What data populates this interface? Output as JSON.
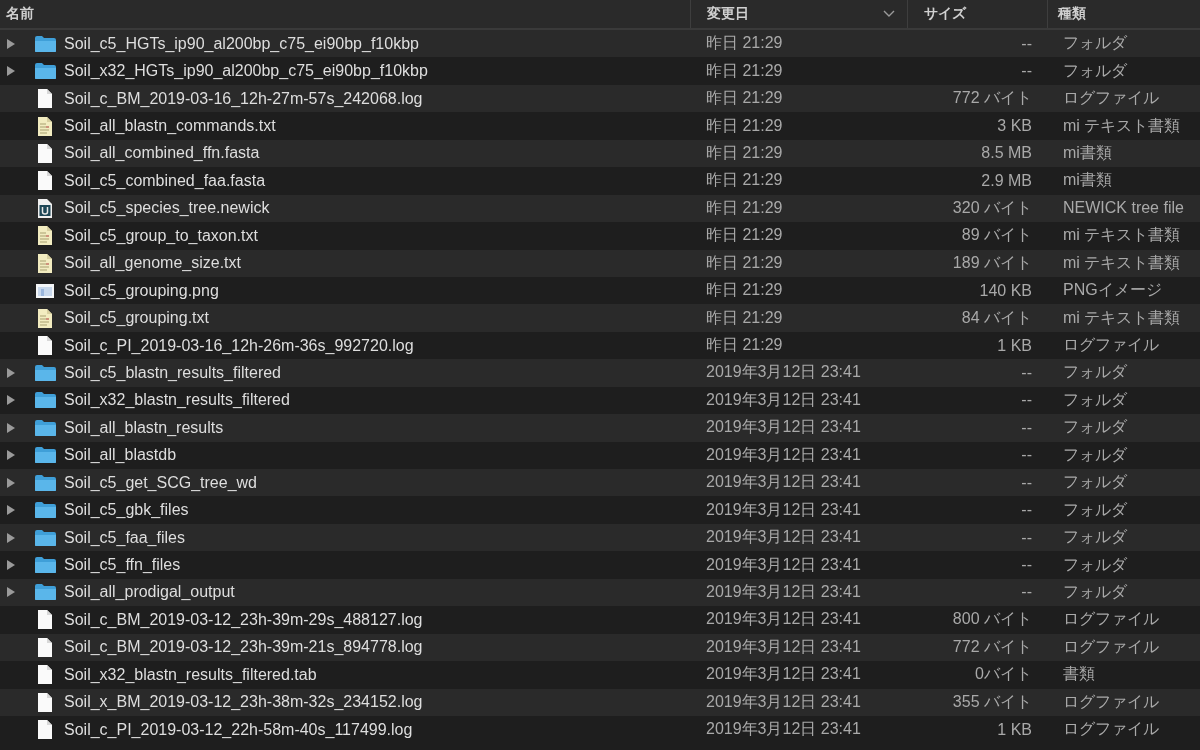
{
  "columns": [
    {
      "label": "名前",
      "sorted": false
    },
    {
      "label": "変更日",
      "sorted": true
    },
    {
      "label": "サイズ",
      "sorted": false
    },
    {
      "label": "種類",
      "sorted": false
    }
  ],
  "rows": [
    {
      "kind": "folder",
      "expanded": false,
      "name": "Soil_c5_HGTs_ip90_al200bp_c75_ei90bp_f10kbp",
      "date": "昨日 21:29",
      "size": "--",
      "file_type": "フォルダ"
    },
    {
      "kind": "folder",
      "expanded": false,
      "name": "Soil_x32_HGTs_ip90_al200bp_c75_ei90bp_f10kbp",
      "date": "昨日 21:29",
      "size": "--",
      "file_type": "フォルダ"
    },
    {
      "kind": "document",
      "name": "Soil_c_BM_2019-03-16_12h-27m-57s_242068.log",
      "date": "昨日 21:29",
      "size": "772 バイト",
      "file_type": "ログファイル"
    },
    {
      "kind": "text",
      "name": "Soil_all_blastn_commands.txt",
      "date": "昨日 21:29",
      "size": "3 KB",
      "file_type": "mi テキスト書類"
    },
    {
      "kind": "document",
      "name": "Soil_all_combined_ffn.fasta",
      "date": "昨日 21:29",
      "size": "8.5 MB",
      "file_type": "mi書類"
    },
    {
      "kind": "document",
      "name": "Soil_c5_combined_faa.fasta",
      "date": "昨日 21:29",
      "size": "2.9 MB",
      "file_type": "mi書類"
    },
    {
      "kind": "tree",
      "name": "Soil_c5_species_tree.newick",
      "date": "昨日 21:29",
      "size": "320 バイト",
      "file_type": "NEWICK tree file"
    },
    {
      "kind": "text",
      "name": "Soil_c5_group_to_taxon.txt",
      "date": "昨日 21:29",
      "size": "89 バイト",
      "file_type": "mi テキスト書類"
    },
    {
      "kind": "text",
      "name": "Soil_all_genome_size.txt",
      "date": "昨日 21:29",
      "size": "189 バイト",
      "file_type": "mi テキスト書類"
    },
    {
      "kind": "image",
      "name": "Soil_c5_grouping.png",
      "date": "昨日 21:29",
      "size": "140 KB",
      "file_type": "PNGイメージ"
    },
    {
      "kind": "text",
      "name": "Soil_c5_grouping.txt",
      "date": "昨日 21:29",
      "size": "84 バイト",
      "file_type": "mi テキスト書類"
    },
    {
      "kind": "document",
      "name": "Soil_c_PI_2019-03-16_12h-26m-36s_992720.log",
      "date": "昨日 21:29",
      "size": "1 KB",
      "file_type": "ログファイル"
    },
    {
      "kind": "folder",
      "expanded": false,
      "name": "Soil_c5_blastn_results_filtered",
      "date": "2019年3月12日 23:41",
      "size": "--",
      "file_type": "フォルダ"
    },
    {
      "kind": "folder",
      "expanded": false,
      "name": "Soil_x32_blastn_results_filtered",
      "date": "2019年3月12日 23:41",
      "size": "--",
      "file_type": "フォルダ"
    },
    {
      "kind": "folder",
      "expanded": false,
      "name": "Soil_all_blastn_results",
      "date": "2019年3月12日 23:41",
      "size": "--",
      "file_type": "フォルダ"
    },
    {
      "kind": "folder",
      "expanded": false,
      "name": "Soil_all_blastdb",
      "date": "2019年3月12日 23:41",
      "size": "--",
      "file_type": "フォルダ"
    },
    {
      "kind": "folder",
      "expanded": false,
      "name": "Soil_c5_get_SCG_tree_wd",
      "date": "2019年3月12日 23:41",
      "size": "--",
      "file_type": "フォルダ"
    },
    {
      "kind": "folder",
      "expanded": false,
      "name": "Soil_c5_gbk_files",
      "date": "2019年3月12日 23:41",
      "size": "--",
      "file_type": "フォルダ"
    },
    {
      "kind": "folder",
      "expanded": false,
      "name": "Soil_c5_faa_files",
      "date": "2019年3月12日 23:41",
      "size": "--",
      "file_type": "フォルダ"
    },
    {
      "kind": "folder",
      "expanded": false,
      "name": "Soil_c5_ffn_files",
      "date": "2019年3月12日 23:41",
      "size": "--",
      "file_type": "フォルダ"
    },
    {
      "kind": "folder",
      "expanded": false,
      "name": "Soil_all_prodigal_output",
      "date": "2019年3月12日 23:41",
      "size": "--",
      "file_type": "フォルダ"
    },
    {
      "kind": "document",
      "name": "Soil_c_BM_2019-03-12_23h-39m-29s_488127.log",
      "date": "2019年3月12日 23:41",
      "size": "800 バイト",
      "file_type": "ログファイル"
    },
    {
      "kind": "document",
      "name": "Soil_c_BM_2019-03-12_23h-39m-21s_894778.log",
      "date": "2019年3月12日 23:41",
      "size": "772 バイト",
      "file_type": "ログファイル"
    },
    {
      "kind": "document",
      "name": "Soil_x32_blastn_results_filtered.tab",
      "date": "2019年3月12日 23:41",
      "size": "0バイト",
      "file_type": "書類"
    },
    {
      "kind": "document",
      "name": "Soil_x_BM_2019-03-12_23h-38m-32s_234152.log",
      "date": "2019年3月12日 23:41",
      "size": "355 バイト",
      "file_type": "ログファイル"
    },
    {
      "kind": "document",
      "name": "Soil_c_PI_2019-03-12_22h-58m-40s_117499.log",
      "date": "2019年3月12日 23:41",
      "size": "1 KB",
      "file_type": "ログファイル"
    }
  ]
}
